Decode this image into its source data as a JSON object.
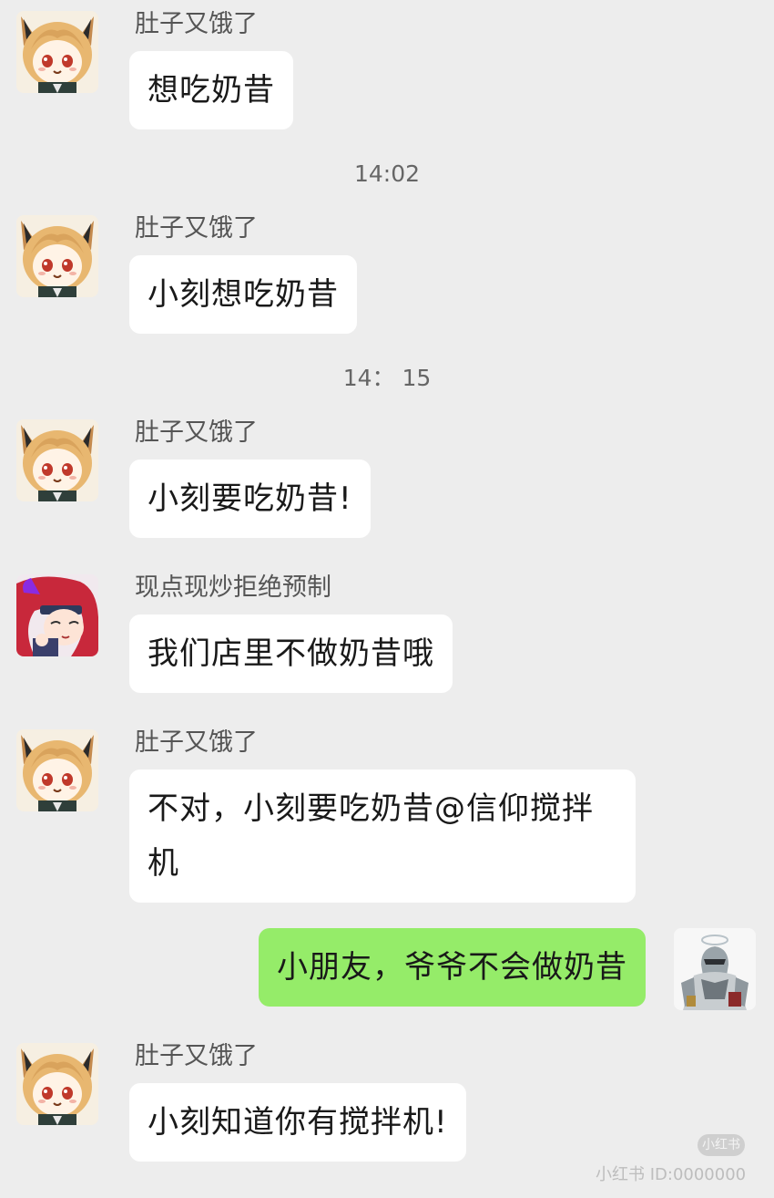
{
  "conversation": {
    "messages": [
      {
        "sender": "肚子又饿了",
        "text": "想吃奶昔"
      },
      {
        "sender": "肚子又饿了",
        "text": "小刻想吃奶昔"
      },
      {
        "sender": "肚子又饿了",
        "text": "小刻要吃奶昔!"
      },
      {
        "sender": "现点现炒拒绝预制",
        "text": "我们店里不做奶昔哦"
      },
      {
        "sender": "肚子又饿了",
        "text_line1": "不对，小刻要吃奶昔@信仰搅拌",
        "text_line2": "机"
      },
      {
        "sender": "",
        "text": "小朋友，爷爷不会做奶昔"
      },
      {
        "sender": "肚子又饿了",
        "text": "小刻知道你有搅拌机!"
      }
    ],
    "timestamps": [
      "14:02",
      "14： 15"
    ]
  },
  "watermark": {
    "badge": "小红书",
    "text": "小红书 ID:0000000"
  },
  "colors": {
    "background": "#ededed",
    "incoming_bubble": "#ffffff",
    "outgoing_bubble": "#95ec69"
  },
  "icons": {
    "avatar_a": "cat-girl-avatar-icon",
    "avatar_b": "red-hair-girl-avatar-icon",
    "avatar_self": "armored-knight-avatar-icon"
  }
}
